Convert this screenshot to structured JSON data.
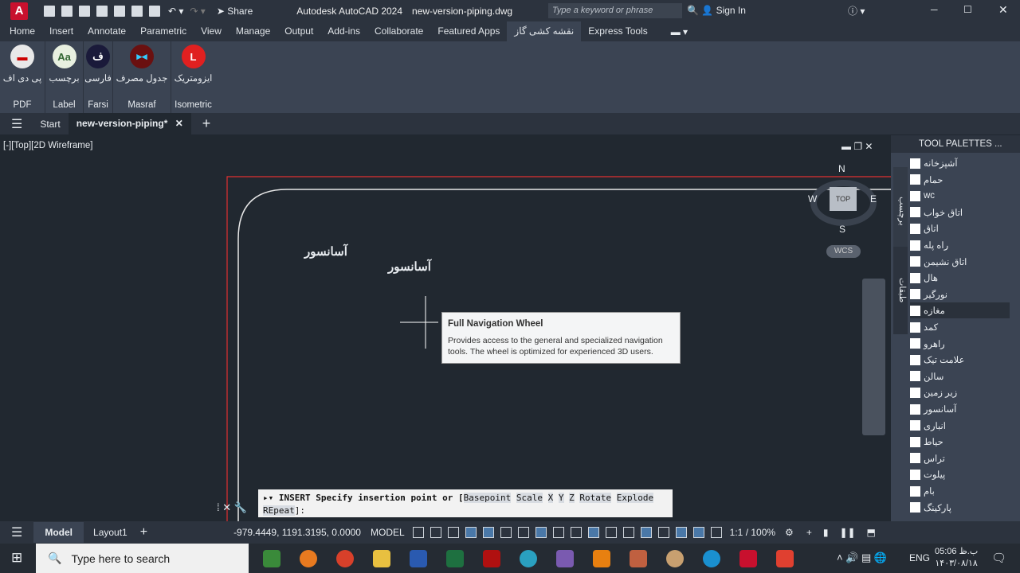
{
  "titlebar": {
    "app_title": "Autodesk AutoCAD 2024",
    "file_name": "new-version-piping.dwg",
    "share": "Share",
    "search_placeholder": "Type a keyword or phrase",
    "sign_in": "Sign In"
  },
  "ribbon_tabs": [
    "Home",
    "Insert",
    "Annotate",
    "Parametric",
    "View",
    "Manage",
    "Output",
    "Add-ins",
    "Collaborate",
    "Featured Apps",
    "نقشه کشی گاز",
    "Express Tools"
  ],
  "ribbon_panels": [
    {
      "label": "پی دی اف",
      "title": "PDF",
      "icon": "pdf-icon",
      "color": "#e8e8e8"
    },
    {
      "label": "برچسب",
      "title": "Label",
      "icon": "label-icon",
      "color": "#e8f0e0"
    },
    {
      "label": "فارسی",
      "title": "Farsi",
      "icon": "farsi-icon",
      "color": "#1a1a3a"
    },
    {
      "label": "جدول مصرف",
      "title": "Masraf",
      "icon": "masraf-icon",
      "color": "#6a1010"
    },
    {
      "label": "ایزومتریک",
      "title": "Isometric",
      "icon": "isometric-icon",
      "color": "#e02020"
    }
  ],
  "file_tabs": {
    "start": "Start",
    "active": "new-version-piping*"
  },
  "viewport": {
    "label": "[-][Top][2D Wireframe]",
    "texts": [
      "آسانسور",
      "آسانسور"
    ]
  },
  "viewcube": {
    "n": "N",
    "s": "S",
    "e": "E",
    "w": "W",
    "top": "TOP",
    "wcs": "WCS"
  },
  "tooltip": {
    "title": "Full Navigation Wheel",
    "body": "Provides access to the general and specialized navigation tools. The wheel is optimized for experienced 3D users."
  },
  "command": {
    "prefix": "INSERT Specify insertion point or [",
    "options": [
      "Basepoint",
      "Scale",
      "X",
      "Y",
      "Z",
      "Rotate",
      "Explode"
    ],
    "line2": "REpeat",
    "suffix": "]:"
  },
  "palette": {
    "title": "TOOL PALETTES ...",
    "side_tabs": [
      "برچسب",
      "طبقات"
    ],
    "items": [
      "آشپزخانه",
      "حمام",
      "wc",
      "اتاق خواب",
      "اتاق",
      "راه پله",
      "اتاق نشیمن",
      "هال",
      "نورگیر",
      "مغازه",
      "کمد",
      "راهرو",
      "علامت تیک",
      "سالن",
      "زیر زمین",
      "آسانسور",
      "انباری",
      "حیاط",
      "تراس",
      "پیلوت",
      "بام",
      "پارکینگ"
    ],
    "selected": "مغازه"
  },
  "status": {
    "model_tab": "Model",
    "layout_tab": "Layout1",
    "coords": "-979.4449, 1191.3195, 0.0000",
    "space": "MODEL",
    "scale": "1:1 / 100%"
  },
  "taskbar": {
    "search_placeholder": "Type here to search",
    "lang": "ENG",
    "time": "05:06 ب.ظ",
    "date": "۱۴۰۳/۰۸/۱۸"
  }
}
